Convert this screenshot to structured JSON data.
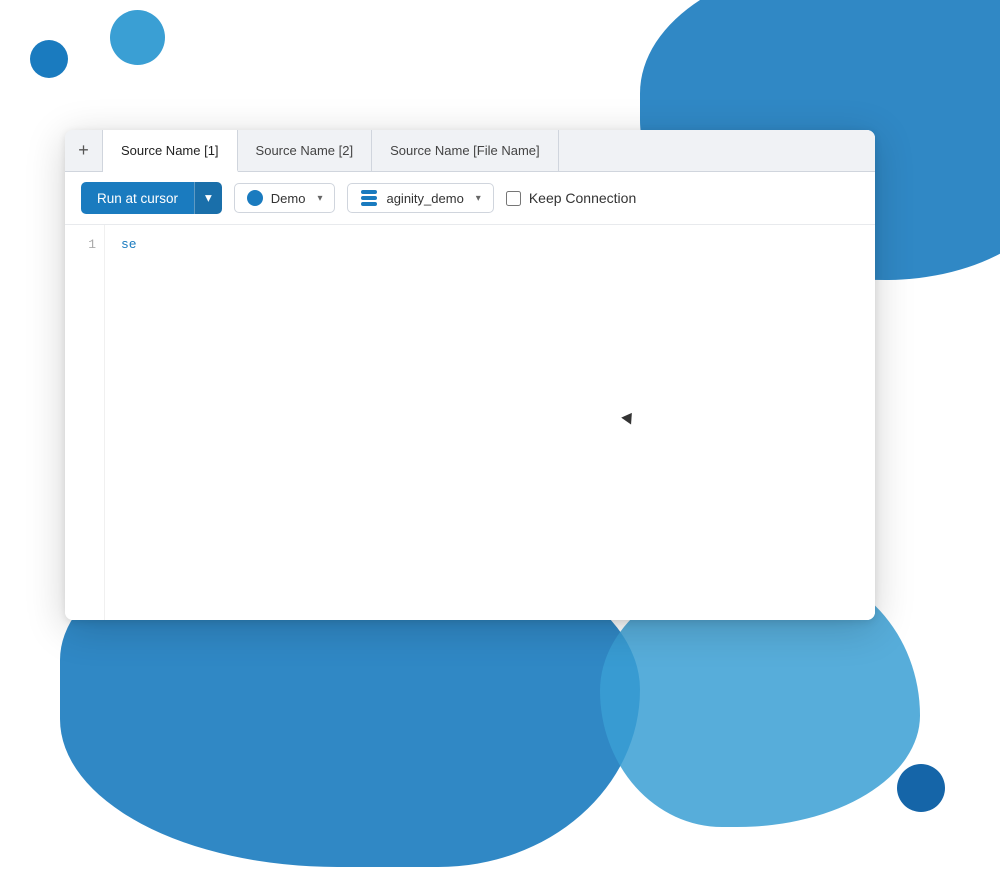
{
  "colors": {
    "primary_blue": "#1a7bbf",
    "dark_blue": "#1565a8",
    "mid_blue": "#3a9fd4",
    "light_blue": "#1a6faa"
  },
  "tabs": {
    "add_label": "+",
    "items": [
      {
        "label": "Source Name [1]",
        "active": true
      },
      {
        "label": "Source Name [2]",
        "active": false
      },
      {
        "label": "Source Name [File Name]",
        "active": false
      }
    ]
  },
  "toolbar": {
    "run_button_label": "Run at cursor",
    "dropdown_arrow": "▾",
    "connection_dropdown": {
      "icon_type": "circle",
      "value": "Demo"
    },
    "database_dropdown": {
      "icon_type": "db",
      "value": "aginity_demo"
    },
    "keep_connection_label": "Keep Connection",
    "keep_connection_checked": false
  },
  "editor": {
    "line_numbers": [
      "1"
    ],
    "code_line_1": "se"
  },
  "cursor": {
    "symbol": "↖"
  }
}
